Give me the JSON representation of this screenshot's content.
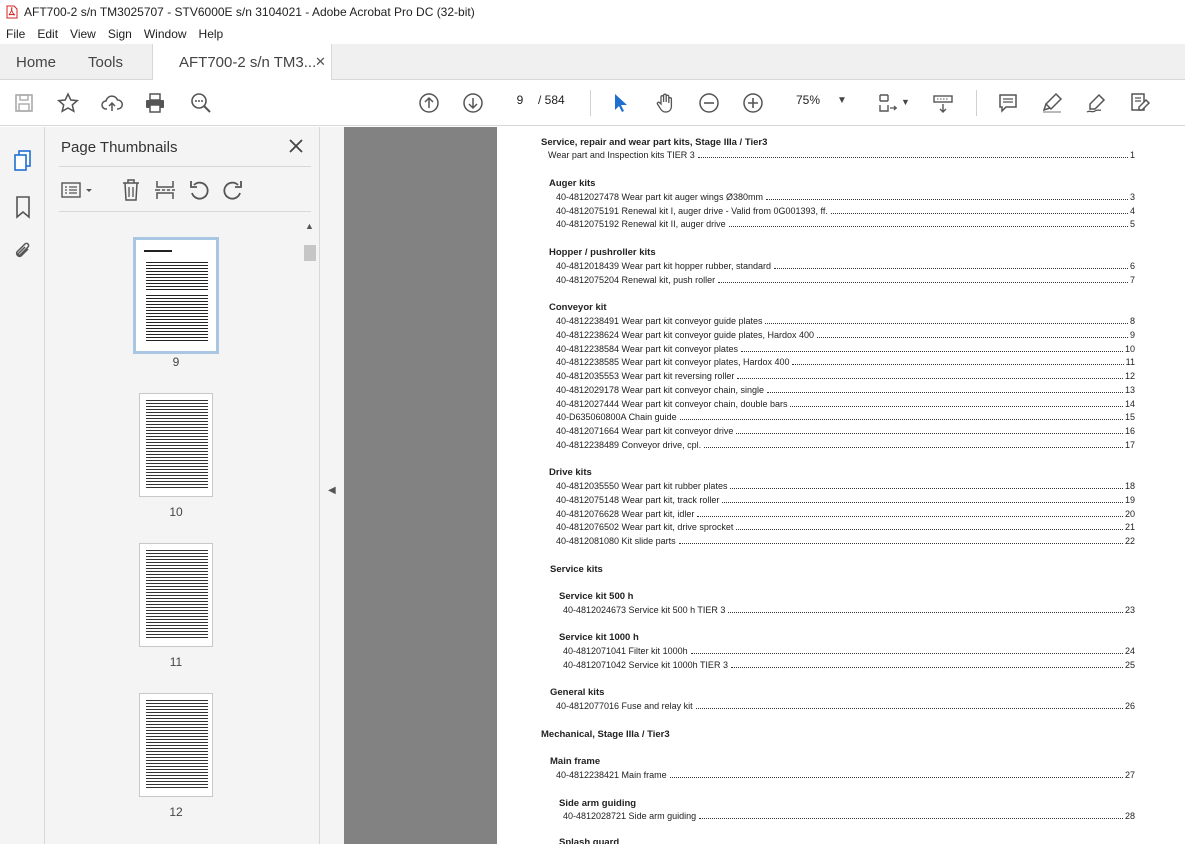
{
  "window": {
    "title": "AFT700-2 s/n TM3025707 - STV6000E s/n 3104021 - Adobe Acrobat Pro DC (32-bit)"
  },
  "menu": [
    "File",
    "Edit",
    "View",
    "Sign",
    "Window",
    "Help"
  ],
  "tabs": {
    "home": "Home",
    "tools": "Tools",
    "doc": "AFT700-2 s/n TM3..."
  },
  "nav": {
    "page": "9",
    "total": "/ 584",
    "zoom": "75%"
  },
  "panel": {
    "title": "Page Thumbnails"
  },
  "thumbnails": [
    {
      "label": "9"
    },
    {
      "label": "10"
    },
    {
      "label": "11"
    },
    {
      "label": "12"
    }
  ],
  "toc": [
    {
      "kind": "head",
      "text": "Service, repair and wear part kits, Stage IIIa / Tier3"
    },
    {
      "kind": "line",
      "text": "Wear part and Inspection kits TIER 3",
      "page": "1"
    },
    {
      "kind": "head",
      "text": "Auger kits"
    },
    {
      "kind": "line",
      "text": "40-4812027478 Wear part kit auger wings Ø380mm",
      "page": "3"
    },
    {
      "kind": "line",
      "text": "40-4812075191 Renewal kit I, auger drive - Valid from 0G001393, ff.",
      "page": "4"
    },
    {
      "kind": "line",
      "text": "40-4812075192 Renewal kit II, auger drive",
      "page": "5"
    },
    {
      "kind": "head",
      "text": "Hopper / pushroller kits"
    },
    {
      "kind": "line",
      "text": "40-4812018439 Wear part kit hopper rubber, standard",
      "page": "6"
    },
    {
      "kind": "line",
      "text": "40-4812075204 Renewal kit, push roller",
      "page": "7"
    },
    {
      "kind": "head",
      "text": "Conveyor kit"
    },
    {
      "kind": "line",
      "text": "40-4812238491 Wear part kit conveyor guide plates",
      "page": "8"
    },
    {
      "kind": "line",
      "text": "40-4812238624 Wear part kit conveyor guide plates, Hardox 400",
      "page": "9"
    },
    {
      "kind": "line",
      "text": "40-4812238584 Wear part kit conveyor plates",
      "page": "10"
    },
    {
      "kind": "line",
      "text": "40-4812238585 Wear part kit conveyor plates, Hardox 400",
      "page": "11"
    },
    {
      "kind": "line",
      "text": "40-4812035553 Wear part kit reversing roller",
      "page": "12"
    },
    {
      "kind": "line",
      "text": "40-4812029178 Wear part kit conveyor chain, single",
      "page": "13"
    },
    {
      "kind": "line",
      "text": "40-4812027444 Wear part kit conveyor chain, double bars",
      "page": "14"
    },
    {
      "kind": "line",
      "text": "40-D635060800A Chain guide",
      "page": "15"
    },
    {
      "kind": "line",
      "text": "40-4812071664 Wear part kit conveyor drive",
      "page": "16"
    },
    {
      "kind": "line",
      "text": "40-4812238489 Conveyor drive, cpl.",
      "page": "17"
    },
    {
      "kind": "head",
      "text": "Drive kits"
    },
    {
      "kind": "line",
      "text": "40-4812035550 Wear part kit rubber plates",
      "page": "18"
    },
    {
      "kind": "line",
      "text": "40-4812075148 Wear part kit, track roller",
      "page": "19"
    },
    {
      "kind": "line",
      "text": "40-4812076628 Wear part kit, idler",
      "page": "20"
    },
    {
      "kind": "line",
      "text": "40-4812076502 Wear part kit, drive sprocket",
      "page": "21"
    },
    {
      "kind": "line",
      "text": "40-4812081080 Kit slide parts",
      "page": "22"
    },
    {
      "kind": "head",
      "text": "Service kits"
    },
    {
      "kind": "head",
      "text": "Service kit 500 h"
    },
    {
      "kind": "line",
      "text": "40-4812024673 Service kit 500 h TIER 3",
      "page": "23"
    },
    {
      "kind": "head",
      "text": "Service kit 1000 h"
    },
    {
      "kind": "line",
      "text": "40-4812071041 Filter kit 1000h",
      "page": "24"
    },
    {
      "kind": "line",
      "text": "40-4812071042 Service kit 1000h TIER 3",
      "page": "25"
    },
    {
      "kind": "head",
      "text": "General kits"
    },
    {
      "kind": "line",
      "text": "40-4812077016 Fuse and relay kit",
      "page": "26"
    },
    {
      "kind": "head",
      "text": "Mechanical, Stage IIIa  / Tier3"
    },
    {
      "kind": "head",
      "text": "Main frame"
    },
    {
      "kind": "line",
      "text": "40-4812238421 Main frame",
      "page": "27"
    },
    {
      "kind": "head",
      "text": "Side arm guiding"
    },
    {
      "kind": "line",
      "text": "40-4812028721 Side arm guiding",
      "page": "28"
    },
    {
      "kind": "head",
      "text": "Splash guard"
    }
  ]
}
